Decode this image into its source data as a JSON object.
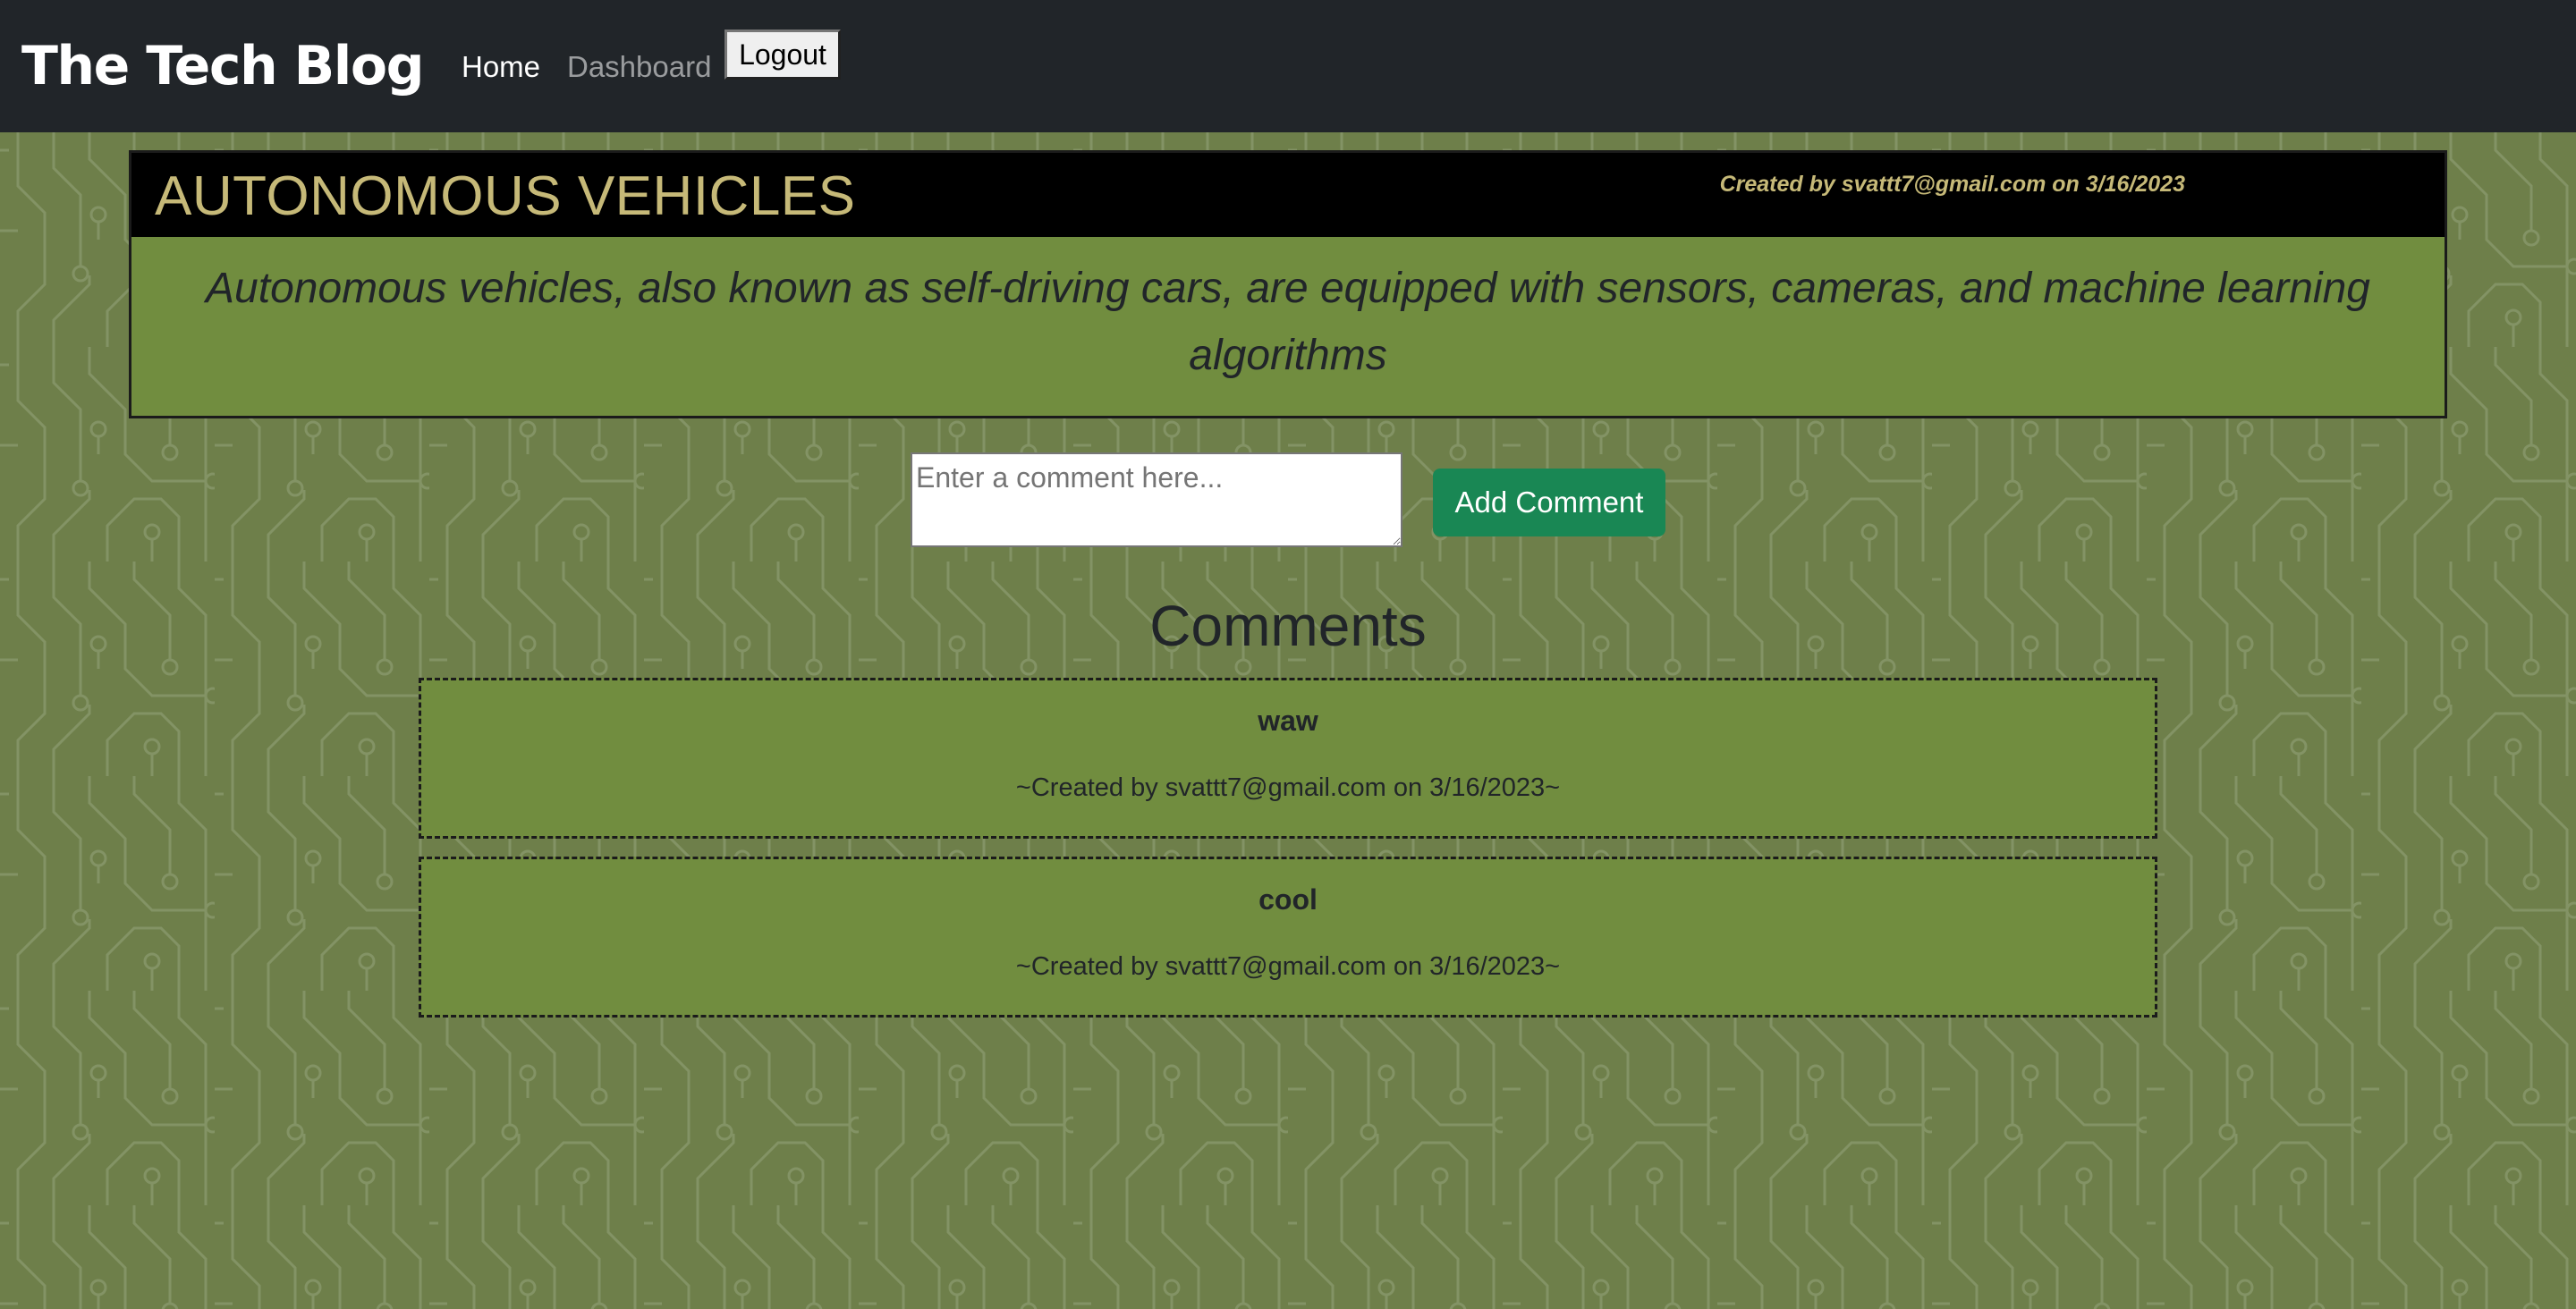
{
  "nav": {
    "brand": "The Tech Blog",
    "links": [
      "Home",
      "Dashboard"
    ],
    "logout_label": "Logout"
  },
  "post": {
    "title": "AUTONOMOUS VEHICLES",
    "meta": "Created by svattt7@gmail.com on 3/16/2023",
    "body": "Autonomous vehicles, also known as self-driving cars, are equipped with sensors, cameras, and machine learning algorithms"
  },
  "comment_form": {
    "placeholder": "Enter a comment here...",
    "value": "",
    "submit_label": "Add Comment"
  },
  "comments_heading": "Comments",
  "comments": [
    {
      "text": "waw",
      "meta": "~Created by svattt7@gmail.com on 3/16/2023~"
    },
    {
      "text": "cool",
      "meta": "~Created by svattt7@gmail.com on 3/16/2023~"
    }
  ],
  "colors": {
    "navbar": "#212529",
    "page_background": "#6e7f4a",
    "card": "#718d3f",
    "title": "#c6b978",
    "button": "#198754"
  }
}
